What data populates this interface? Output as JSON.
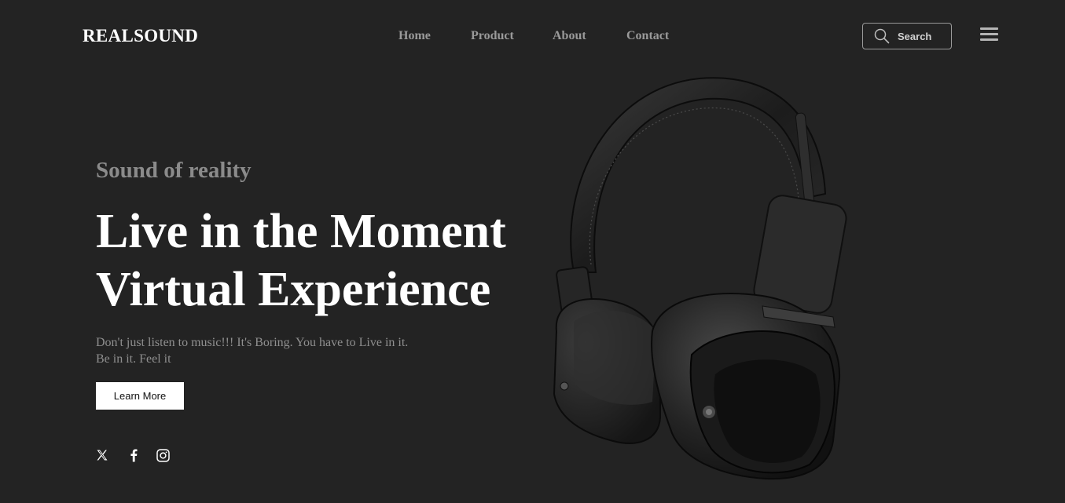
{
  "brand": {
    "logo": "REALSOUND"
  },
  "nav": {
    "items": [
      {
        "label": "Home"
      },
      {
        "label": "Product"
      },
      {
        "label": "About"
      },
      {
        "label": "Contact"
      }
    ]
  },
  "search": {
    "label": "Search",
    "icon": "search-icon"
  },
  "menu": {
    "icon": "hamburger-menu-icon"
  },
  "hero": {
    "subtitle": "Sound of reality",
    "headline_line1": "Live in the Moment",
    "headline_line2": "Virtual Experience",
    "description_line1": "Don't just listen to music!!! It's Boring. You have to Live in it.",
    "description_line2": "Be in it. Feel it",
    "cta_label": "Learn More",
    "image": "headphones-product-image"
  },
  "social": [
    {
      "icon": "x-twitter-icon"
    },
    {
      "icon": "facebook-icon"
    },
    {
      "icon": "instagram-icon"
    }
  ],
  "colors": {
    "background": "#232323",
    "text_primary": "#ffffff",
    "text_muted": "#8f8f8f",
    "button_bg": "#ffffff"
  }
}
